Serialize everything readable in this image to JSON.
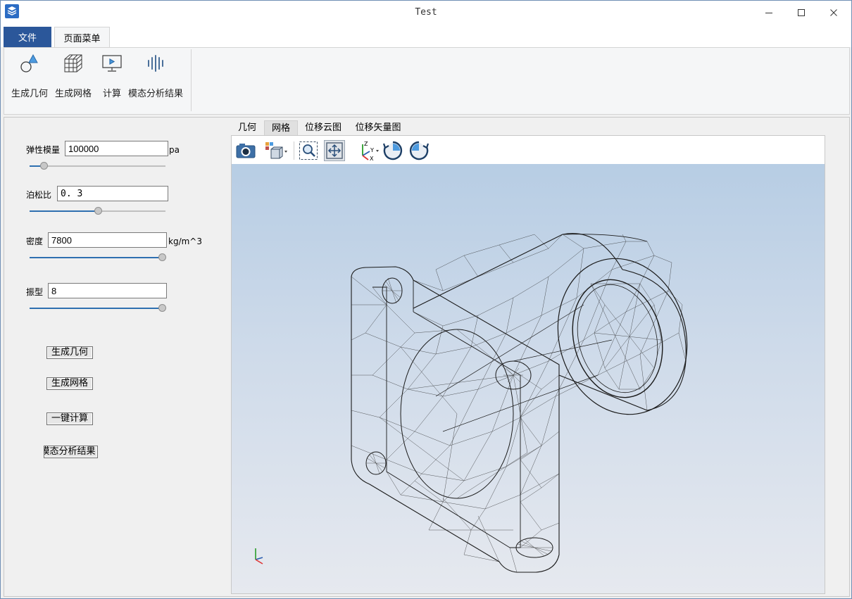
{
  "window": {
    "title": "Test"
  },
  "ribbon": {
    "tabs": [
      "文件",
      "页面菜单"
    ],
    "items": [
      {
        "label": "生成几何",
        "icon": "geometry-shapes-icon"
      },
      {
        "label": "生成网格",
        "icon": "mesh-cube-icon"
      },
      {
        "label": "计算",
        "icon": "compute-monitor-icon"
      },
      {
        "label": "模态分析结果",
        "icon": "modal-waveform-icon"
      }
    ]
  },
  "params": {
    "elastic_modulus": {
      "label": "弹性模量",
      "value": "100000",
      "unit": "pa",
      "slider_fraction": 0.08
    },
    "poisson_ratio": {
      "label": "泊松比",
      "value": "0. 3",
      "slider_fraction": 0.5
    },
    "density": {
      "label": "密度",
      "value": "7800",
      "unit": "kg/m^3",
      "slider_fraction": 1.0
    },
    "mode_shape": {
      "label": "振型",
      "value": "8",
      "slider_fraction": 1.0
    }
  },
  "buttons": {
    "gen_geometry": "生成几何",
    "gen_mesh": "生成网格",
    "one_click_compute": "一键计算",
    "modal_result": "模态分析结果"
  },
  "view_tabs": [
    "几何",
    "网格",
    "位移云图",
    "位移矢量图"
  ],
  "active_view_tab": "网格",
  "toolbar_icons": [
    "camera-icon",
    "view-cube-icon",
    "zoom-box-icon",
    "fit-all-icon",
    "axis-orientation-icon",
    "rotate-cw-icon",
    "rotate-ccw-icon"
  ],
  "colors": {
    "accent": "#2b579a",
    "slider_fill": "#2e6fb0",
    "canvas_top": "#b7cde4",
    "canvas_bottom": "#e6e9ef"
  }
}
